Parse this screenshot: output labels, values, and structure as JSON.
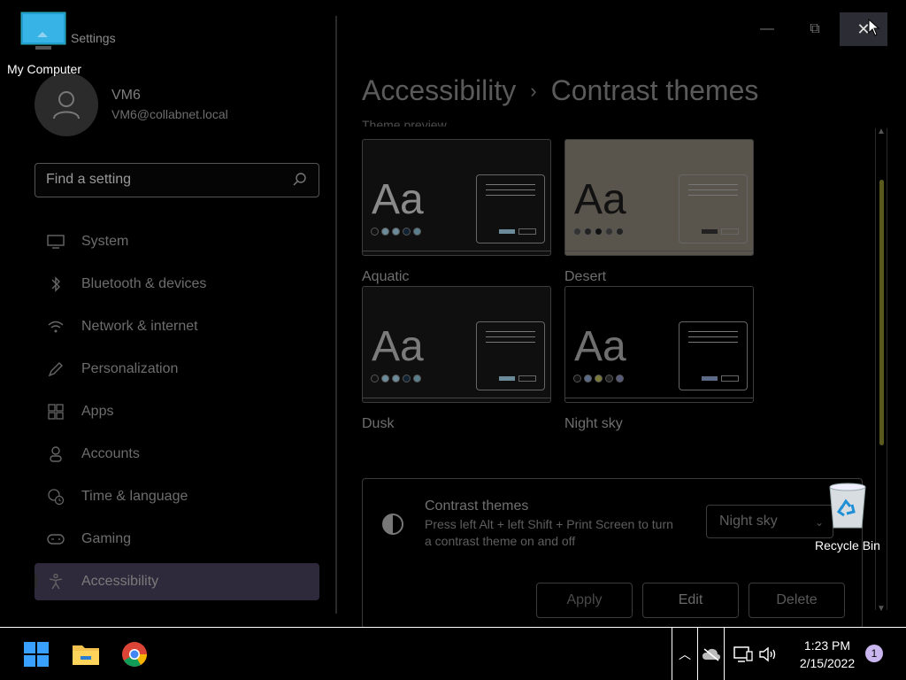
{
  "window": {
    "title": "Settings",
    "controls": {
      "minimize": "—",
      "maximize": "⧉",
      "close": "✕"
    }
  },
  "profile": {
    "name": "VM6",
    "email": "VM6@collabnet.local"
  },
  "search": {
    "placeholder": "Find a setting"
  },
  "sidebar": {
    "items": [
      {
        "label": "System",
        "icon": "monitor-icon"
      },
      {
        "label": "Bluetooth & devices",
        "icon": "bluetooth-icon"
      },
      {
        "label": "Network & internet",
        "icon": "wifi-icon"
      },
      {
        "label": "Personalization",
        "icon": "pencil-icon"
      },
      {
        "label": "Apps",
        "icon": "apps-icon"
      },
      {
        "label": "Accounts",
        "icon": "person-icon"
      },
      {
        "label": "Time & language",
        "icon": "globe-clock-icon"
      },
      {
        "label": "Gaming",
        "icon": "gamepad-icon"
      },
      {
        "label": "Accessibility",
        "icon": "accessibility-icon",
        "active": true
      }
    ]
  },
  "breadcrumb": {
    "parent": "Accessibility",
    "separator": "›",
    "current": "Contrast themes"
  },
  "theme_preview": {
    "label": "Theme preview",
    "themes": [
      {
        "name": "Aquatic",
        "bg": "#0f0f0f",
        "text": "#8a8a8a",
        "dots": [
          "#111",
          "#6b8a9a",
          "#6b8a9a",
          "#123",
          "#5a7f8c"
        ]
      },
      {
        "name": "Desert",
        "bg": "#5a554c",
        "text": "#111111",
        "dots": [
          "#333",
          "#222",
          "#111",
          "#333",
          "#222"
        ]
      },
      {
        "name": "Dusk",
        "bg": "#0f0f0f",
        "text": "#7b7b7b",
        "dots": [
          "#111",
          "#6b8a9a",
          "#6b8a9a",
          "#123",
          "#5a7f8c"
        ]
      },
      {
        "name": "Night sky",
        "bg": "#000000",
        "text": "#6f6f6f",
        "dots": [
          "#111",
          "#5b6a86",
          "#7a7a3a",
          "#222",
          "#585a7a"
        ]
      }
    ]
  },
  "contrast_panel": {
    "title": "Contrast themes",
    "description": "Press left Alt + left Shift + Print Screen to turn a contrast theme on and off",
    "selected_theme": "Night sky",
    "buttons": {
      "apply": "Apply",
      "edit": "Edit",
      "delete": "Delete"
    }
  },
  "desktop": {
    "my_computer": "My Computer",
    "recycle_bin": "Recycle Bin"
  },
  "taskbar": {
    "time": "1:23 PM",
    "date": "2/15/2022",
    "notifications": "1"
  },
  "colors": {
    "active_nav": "#2f2a3b",
    "scroll_thumb": "#5b5a1e",
    "notif_badge": "#c9b6ef"
  }
}
